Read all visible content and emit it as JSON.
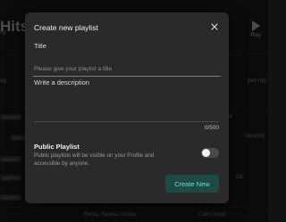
{
  "background": {
    "page_title": "Hits",
    "play_label": "Play",
    "left_fragments": [
      "rgi",
      "ag"
    ],
    "right_fragments": [
      "ped Up)",
      "Version)",
      "ne",
      "CE"
    ],
    "artist": "Rema, Selena Gomez",
    "song": "Calm Down",
    "badge": "MASTER"
  },
  "modal": {
    "title": "Create new playlist",
    "title_label": "Title",
    "title_placeholder": "Please give your playlist a title",
    "description_label": "Write a description",
    "char_count": "0/500",
    "public_label": "Public Playlist",
    "public_description": "Public playlists will be visible on your Profile and accessible by anyone.",
    "public_enabled": false,
    "create_button": "Create New",
    "accent_color": "#19a99a"
  }
}
